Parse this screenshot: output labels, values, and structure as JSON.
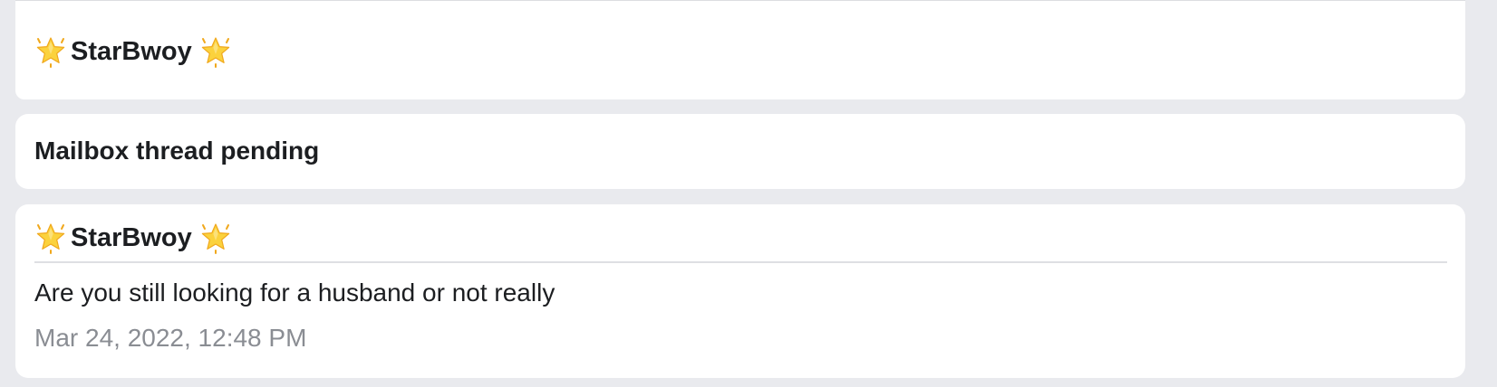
{
  "header": {
    "sender_name": "StarBwoy"
  },
  "status": {
    "text": "Mailbox thread pending"
  },
  "message": {
    "sender_name": "StarBwoy",
    "body": "Are you still looking for a husband or not really",
    "timestamp": "Mar 24, 2022, 12:48 PM"
  },
  "icons": {
    "sender_decoration": "glowing-star-icon"
  },
  "colors": {
    "background": "#e9eaee",
    "card": "#ffffff",
    "text": "#1c1e21",
    "timestamp": "#8a8d93",
    "star": "#f7c531"
  }
}
